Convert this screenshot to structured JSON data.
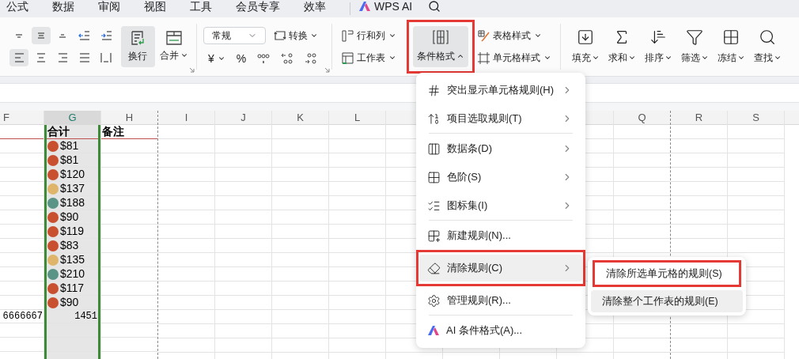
{
  "tabs": [
    {
      "label": "公式"
    },
    {
      "label": "数据"
    },
    {
      "label": "审阅"
    },
    {
      "label": "视图"
    },
    {
      "label": "工具"
    },
    {
      "label": "会员专享"
    },
    {
      "label": "效率"
    }
  ],
  "wps_ai": "WPS AI",
  "alignment": [
    {
      "kind": "top",
      "selected": false
    },
    {
      "kind": "middle",
      "selected": true
    },
    {
      "kind": "bottom",
      "selected": false
    },
    {
      "kind": "outdent",
      "selected": false
    },
    {
      "kind": "indent",
      "selected": false
    },
    {
      "kind": "left",
      "selected": true
    },
    {
      "kind": "center",
      "selected": false
    },
    {
      "kind": "right",
      "selected": false
    },
    {
      "kind": "justify",
      "selected": false
    },
    {
      "kind": "distributed",
      "selected": false
    }
  ],
  "wrap": {
    "label": "换行",
    "selected": true
  },
  "merge": {
    "label": "合并"
  },
  "number_format": {
    "value": "常规"
  },
  "convert": {
    "label": "转换"
  },
  "currency": {
    "label": "¥"
  },
  "percent": {
    "label": "%"
  },
  "rows_cols": {
    "label": "行和列"
  },
  "worksheet": {
    "label": "工作表"
  },
  "conditional_format": {
    "label": "条件格式",
    "expanded": true,
    "annotated": true
  },
  "table_style": {
    "label": "表格样式"
  },
  "cell_style": {
    "label": "单元格样式"
  },
  "tools": [
    {
      "label": "填充",
      "kind": "fill"
    },
    {
      "label": "求和",
      "kind": "sum"
    },
    {
      "label": "排序",
      "kind": "sort"
    },
    {
      "label": "筛选",
      "kind": "filter"
    },
    {
      "label": "冻结",
      "kind": "freeze"
    },
    {
      "label": "查找",
      "kind": "find"
    }
  ],
  "columns": [
    {
      "label": "F",
      "selected": false,
      "page_break": false
    },
    {
      "label": "G",
      "selected": true,
      "page_break": false
    },
    {
      "label": "H",
      "selected": false,
      "page_break": true
    },
    {
      "label": "I",
      "selected": false,
      "page_break": false
    },
    {
      "label": "J",
      "selected": false,
      "page_break": false
    },
    {
      "label": "K",
      "selected": false,
      "page_break": false
    },
    {
      "label": "L",
      "selected": false,
      "page_break": false
    },
    {
      "label": "Q",
      "selected": false,
      "page_break": true
    },
    {
      "label": "R",
      "selected": false,
      "page_break": false
    },
    {
      "label": "S",
      "selected": false,
      "page_break": false
    }
  ],
  "rows": [
    {
      "kind": "header",
      "g": "合计",
      "h": "备注"
    },
    {
      "kind": "value",
      "color": "#c9502e",
      "g": "$81"
    },
    {
      "kind": "value",
      "color": "#c9502e",
      "g": "$81"
    },
    {
      "kind": "value",
      "color": "#c9502e",
      "g": "$120"
    },
    {
      "kind": "value",
      "color": "#dfb56c",
      "g": "$137"
    },
    {
      "kind": "value",
      "color": "#5a9486",
      "g": "$188"
    },
    {
      "kind": "value",
      "color": "#c9502e",
      "g": "$90"
    },
    {
      "kind": "value",
      "color": "#c9502e",
      "g": "$119"
    },
    {
      "kind": "value",
      "color": "#c9502e",
      "g": "$83"
    },
    {
      "kind": "value",
      "color": "#dfb56c",
      "g": "$135"
    },
    {
      "kind": "value",
      "color": "#5a9486",
      "g": "$210"
    },
    {
      "kind": "value",
      "color": "#c9502e",
      "g": "$117"
    },
    {
      "kind": "value",
      "color": "#c9502e",
      "g": "$90"
    },
    {
      "kind": "total",
      "f": "6666667",
      "g": "1451"
    },
    {
      "kind": "empty"
    },
    {
      "kind": "empty"
    },
    {
      "kind": "empty"
    }
  ],
  "menu": {
    "groups": [
      [
        {
          "label": "突出显示单元格规则(H)",
          "kind": "highlight",
          "submenu": true,
          "highlighted": false,
          "annotated": false
        },
        {
          "label": "项目选取规则(T)",
          "kind": "top",
          "submenu": true,
          "highlighted": false,
          "annotated": false
        }
      ],
      [
        {
          "label": "数据条(D)",
          "kind": "databar",
          "submenu": true,
          "highlighted": false,
          "annotated": false
        },
        {
          "label": "色阶(S)",
          "kind": "colorscale",
          "submenu": true,
          "highlighted": false,
          "annotated": false
        },
        {
          "label": "图标集(I)",
          "kind": "iconset",
          "submenu": true,
          "highlighted": false,
          "annotated": false
        }
      ],
      [
        {
          "label": "新建规则(N)...",
          "kind": "new",
          "submenu": false,
          "highlighted": false,
          "annotated": false
        },
        {
          "label": "清除规则(C)",
          "kind": "clear",
          "submenu": true,
          "highlighted": true,
          "annotated": true
        },
        {
          "label": "管理规则(R)...",
          "kind": "manage",
          "submenu": false,
          "highlighted": false,
          "annotated": false
        }
      ],
      [
        {
          "label": "AI 条件格式(A)...",
          "kind": "ai",
          "submenu": false,
          "highlighted": false,
          "annotated": false
        }
      ]
    ]
  },
  "submenu": [
    {
      "label": "清除所选单元格的规则(S)",
      "highlighted": false,
      "annotated": true
    },
    {
      "label": "清除整个工作表的规则(E)",
      "highlighted": true,
      "annotated": false
    }
  ]
}
